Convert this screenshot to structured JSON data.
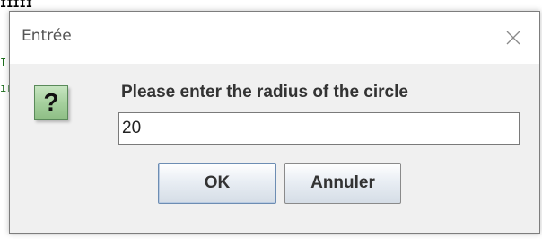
{
  "background": {
    "fragment_top": "IIIII",
    "fragment_left_1": "I",
    "fragment_left_2": "ır"
  },
  "dialog": {
    "title": "Entrée",
    "close_icon": "close-icon",
    "question_icon": "question-icon",
    "question_glyph": "?",
    "message": "Please enter the radius of the circle",
    "input_value": "20",
    "buttons": {
      "ok": "OK",
      "cancel": "Annuler"
    }
  },
  "colors": {
    "icon_green": "#a4cf9c",
    "dialog_bg": "#f0f0f0"
  }
}
